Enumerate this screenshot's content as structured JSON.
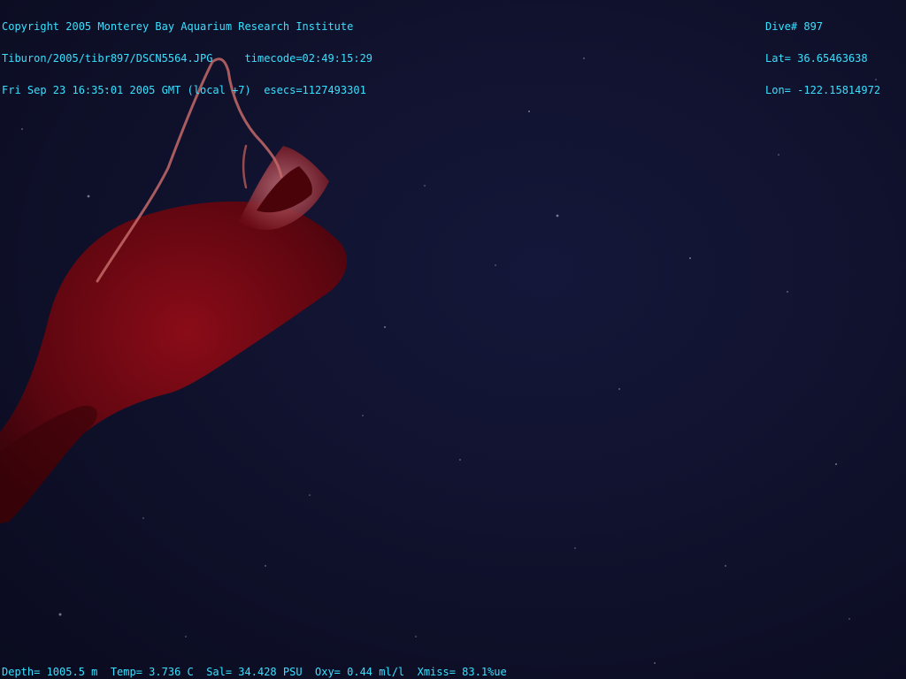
{
  "overlay": {
    "copyright": "Copyright 2005 Monterey Bay Aquarium Research Institute",
    "file_line": "Tiburon/2005/tibr897/DSCN5564.JPG     timecode=02:49:15:29",
    "date_line": "Fri Sep 23 16:35:01 2005 GMT (local +7)  esecs=1127493301",
    "dive": "Dive# 897",
    "lat": "Lat= 36.65463638",
    "lon": "Lon= -122.15814972",
    "sensors": "Depth= 1005.5 m  Temp= 3.736 C  Sal= 34.428 PSU  Oxy= 0.44 ml/l  Xmiss= 83.1%ue"
  },
  "colors": {
    "overlay_text": "#38e0ff",
    "water": "#0f112b",
    "animal_body": "#6e0712",
    "tentacle": "#c46a68"
  }
}
